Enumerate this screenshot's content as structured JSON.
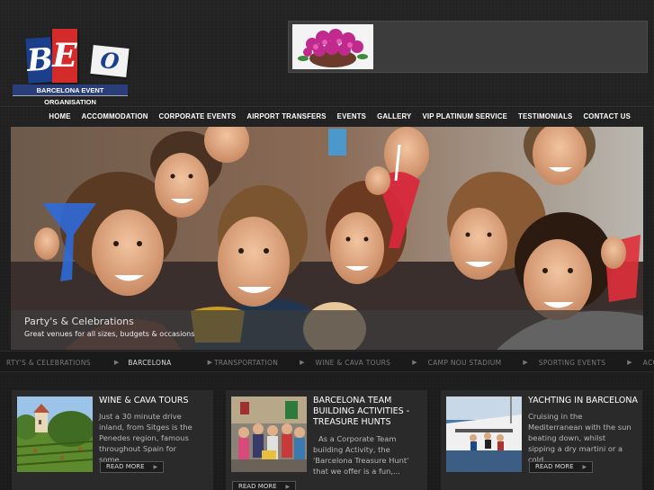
{
  "logo": {
    "letters": [
      "B",
      "E",
      "O"
    ],
    "caption": "BARCELONA EVENT ORGANISATION"
  },
  "nav": {
    "items": [
      "HOME",
      "ACCOMMODATION",
      "CORPORATE EVENTS",
      "AIRPORT TRANSFERS",
      "EVENTS",
      "GALLERY",
      "VIP PLATINUM SERVICE",
      "TESTIMONIALS",
      "CONTACT US"
    ]
  },
  "hero": {
    "title": "Party's & Celebrations",
    "subtitle": "Great venues for all sizes, budgets & occasions"
  },
  "ticker": {
    "items": [
      "RTY'S & CELEBRATIONS",
      "BARCELONA",
      "TRANSPORTATION",
      "WINE & CAVA TOURS",
      "CAMP NOU STADIUM",
      "SPORTING EVENTS",
      "ACC"
    ],
    "active": "BARCELONA"
  },
  "cards": [
    {
      "title": "WINE & CAVA TOURS",
      "body": "Just a 30 minute drive inland, from Sitges is the Penedes region, famous throughout Spain for some...",
      "readmore": "READ MORE"
    },
    {
      "title": "BARCELONA TEAM BUILDING ACTIVITIES - TREASURE HUNTS",
      "body": "As a Corporate Team building Activity, the 'Barcelona Treasure Hunt' that we offer is a fun,...",
      "readmore": "READ MORE"
    },
    {
      "title": "YACHTING IN BARCELONA",
      "body": "Cruising in the Mediterranean with the sun beating down, whilst sipping a dry martini or a cold...",
      "readmore": "READ MORE"
    }
  ],
  "colors": {
    "background": "#1e1e1e",
    "logo_blue": "#1c3f8c",
    "logo_red": "#d32a2a",
    "card_bg": "#2a2a2a"
  }
}
